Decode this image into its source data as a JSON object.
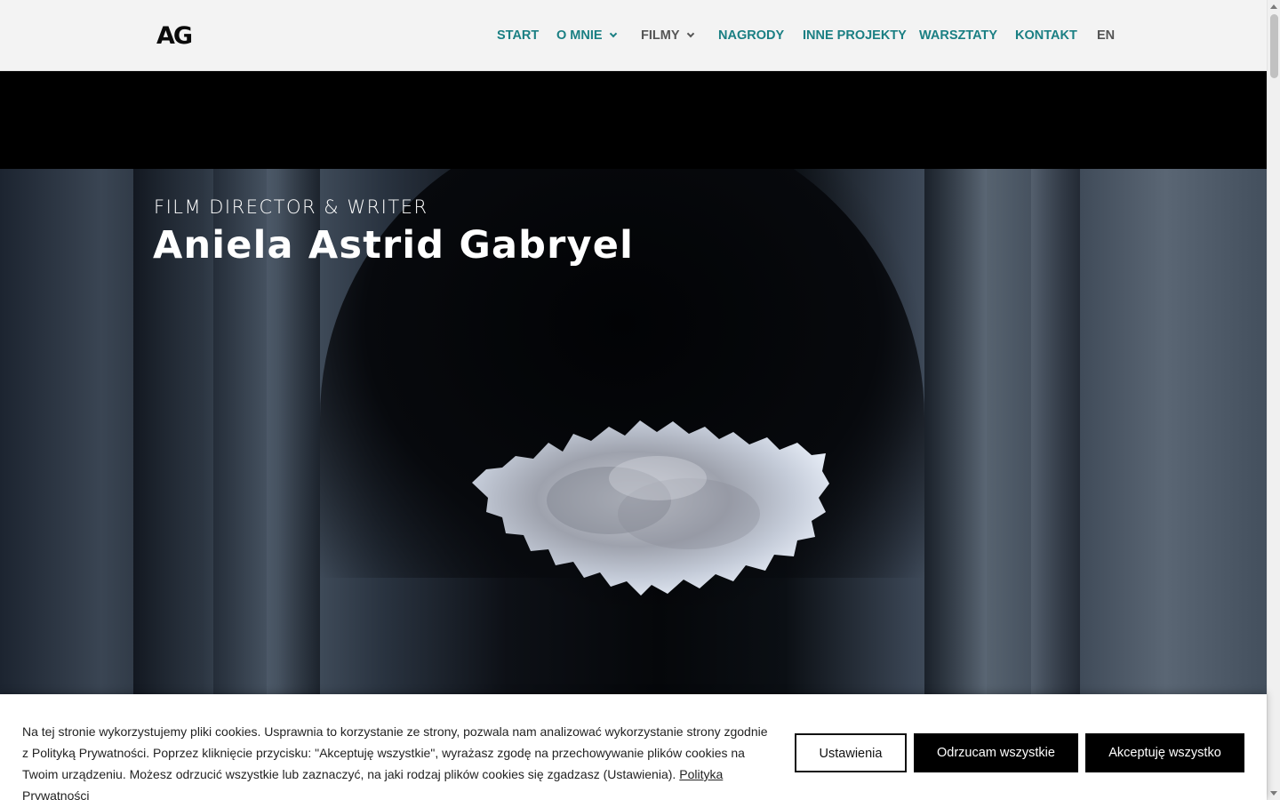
{
  "header": {
    "logo": "AG",
    "nav": [
      {
        "label": "START",
        "has_dropdown": false
      },
      {
        "label": "O MNIE",
        "has_dropdown": true
      },
      {
        "label": "FILMY",
        "has_dropdown": true
      },
      {
        "label": "NAGRODY",
        "has_dropdown": false
      },
      {
        "label": "INNE PROJEKTY",
        "has_dropdown": false
      },
      {
        "label": "WARSZTATY",
        "has_dropdown": false
      },
      {
        "label": "KONTAKT",
        "has_dropdown": false
      },
      {
        "label": "EN",
        "has_dropdown": false
      }
    ]
  },
  "hero": {
    "subtitle": "FILM DIRECTOR & WRITER",
    "title": "Aniela Astrid Gabryel"
  },
  "cookie_banner": {
    "text": "Na tej stronie wykorzystujemy pliki cookies.  Usprawnia to korzystanie ze strony, pozwala nam analizować wykorzystanie strony zgodnie z Polityką Prywatności.  Poprzez kliknięcie przycisku: \"Akceptuję wszystkie\", wyrażasz zgodę na przechowywanie plików cookies na Twoim urządzeniu. Możesz odrzucić wszystkie lub zaznaczyć, na jaki rodzaj plików cookies się zgadzasz (Ustawienia).",
    "privacy_link": "Polityka Prywatności",
    "settings_button": "Ustawienia",
    "reject_button": "Odrzucam wszystkie",
    "accept_button": "Akceptuję wszystko"
  },
  "colors": {
    "nav_accent": "#1a7f83",
    "nav_muted": "#555555",
    "header_bg": "#f3f3f3"
  },
  "icons": {
    "dropdown": "chevron-down-icon",
    "scroll_up": "scroll-up-arrow-icon",
    "scroll_down": "scroll-down-arrow-icon"
  }
}
